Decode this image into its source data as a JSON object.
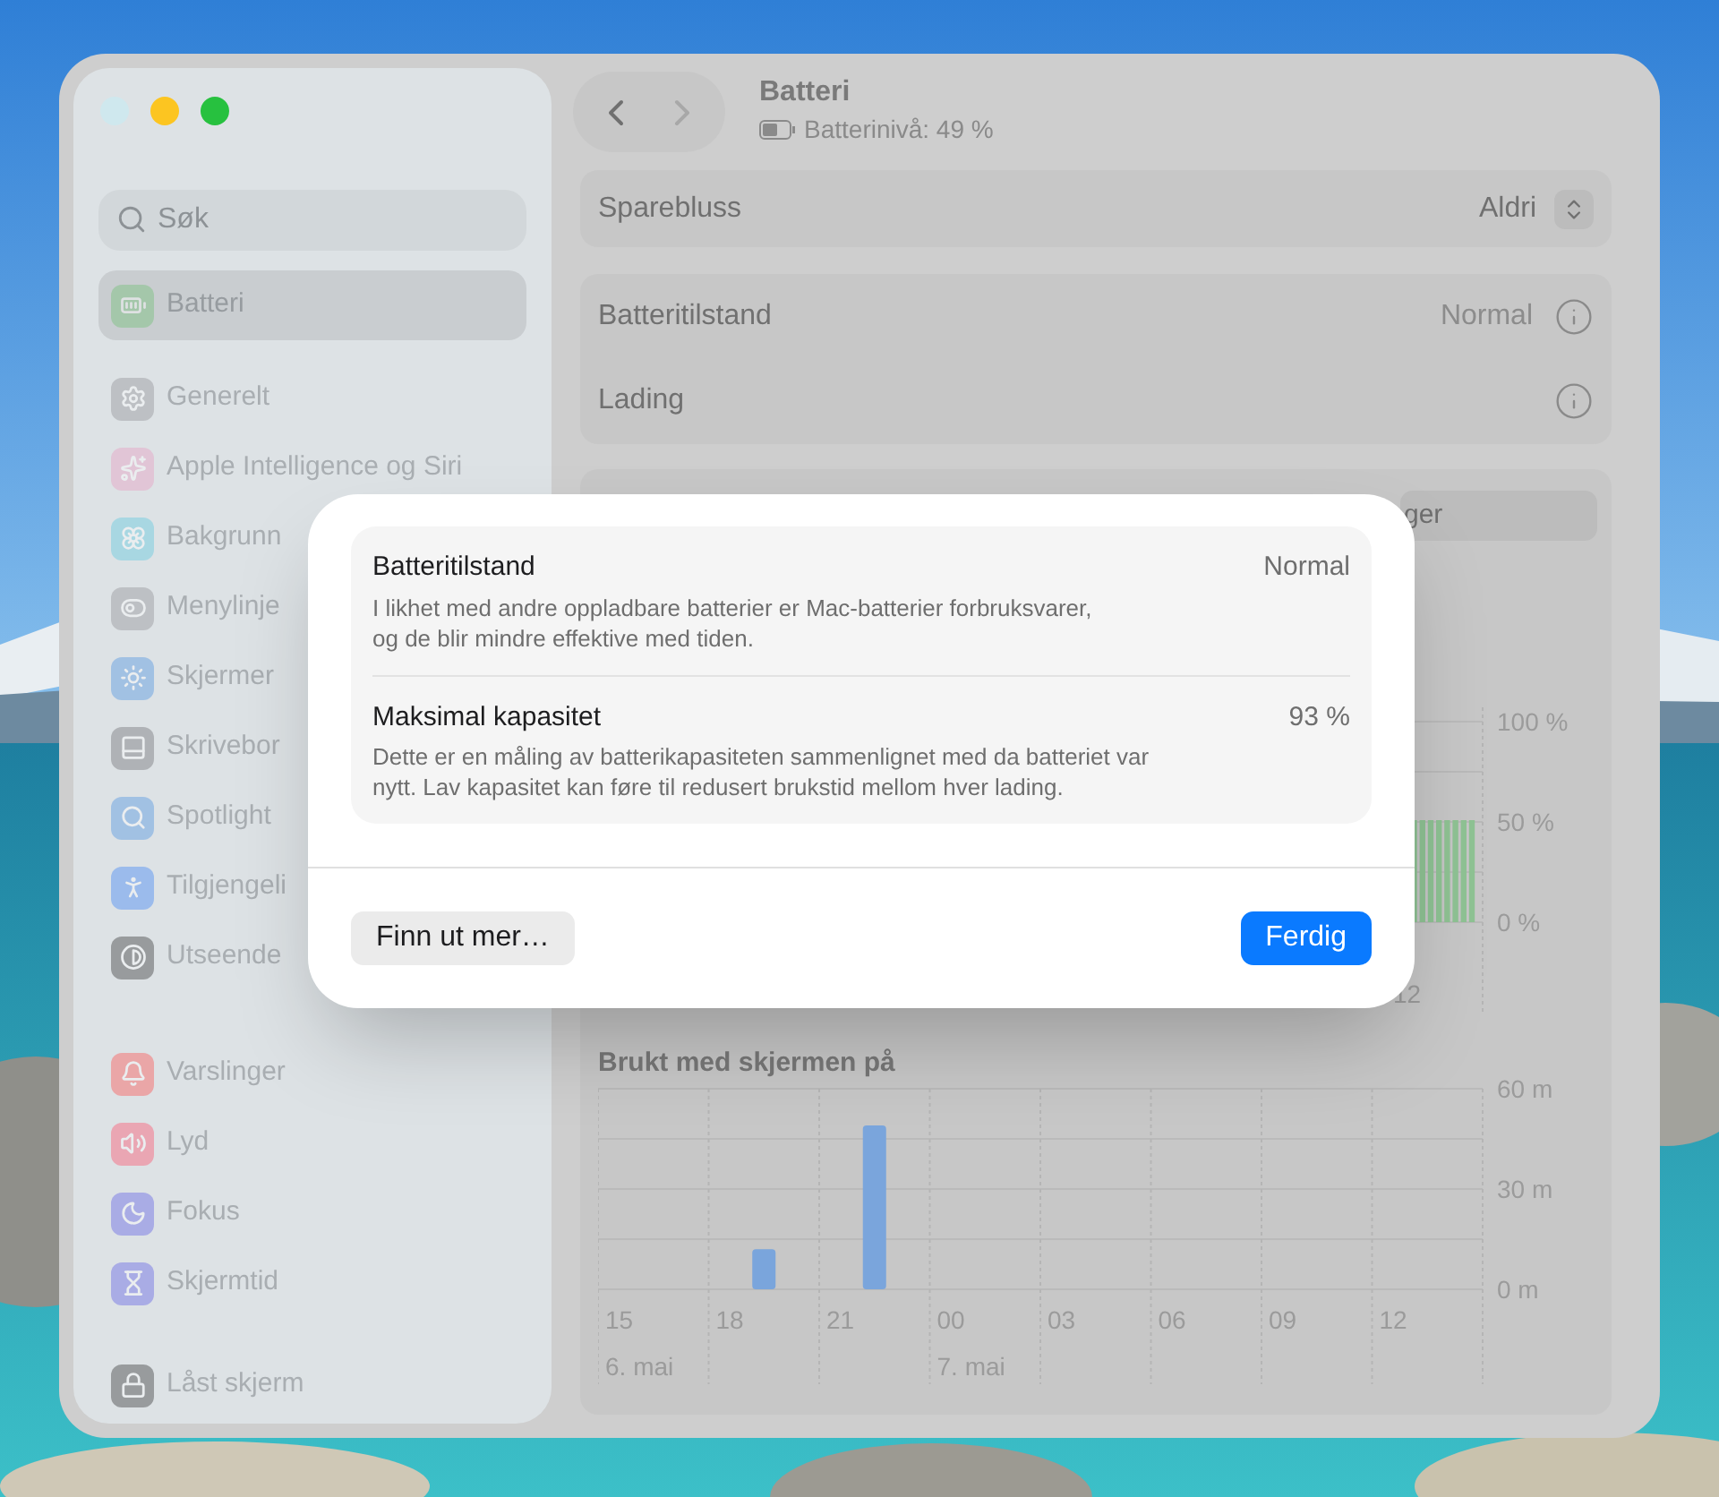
{
  "window": {
    "title": "Batteri",
    "subtitle": "Batterinivå: 49 %"
  },
  "sidebar": {
    "search": {
      "placeholder": "Søk"
    },
    "groups": [
      {
        "items": [
          {
            "label": "Batteri",
            "selected": true
          }
        ]
      },
      {
        "items": [
          {
            "label": "Generelt",
            "selected": false
          },
          {
            "label": "Apple Intelligence og Siri",
            "selected": false
          },
          {
            "label": "Bakgrunn",
            "selected": false
          },
          {
            "label": "Menylinje",
            "selected": false
          },
          {
            "label": "Skjermer",
            "selected": false
          },
          {
            "label": "Skrivebor",
            "selected": false
          },
          {
            "label": "Spotlight",
            "selected": false
          },
          {
            "label": "Tilgjengeli",
            "selected": false
          },
          {
            "label": "Utseende",
            "selected": false
          }
        ]
      },
      {
        "items": [
          {
            "label": "Varslinger",
            "selected": false
          },
          {
            "label": "Lyd",
            "selected": false
          },
          {
            "label": "Fokus",
            "selected": false
          },
          {
            "label": "Skjermtid",
            "selected": false
          }
        ]
      },
      {
        "items": [
          {
            "label": "Låst skjerm",
            "selected": false
          }
        ]
      }
    ]
  },
  "settings": {
    "low_power": {
      "label": "Sparebluss",
      "value": "Aldri"
    },
    "health_rows": [
      {
        "label": "Batteritilstand",
        "value": "Normal"
      },
      {
        "label": "Lading"
      }
    ],
    "range_segment": "ger",
    "level_chart": {
      "y_labels": [
        "100 %",
        "50 %",
        "0 %"
      ],
      "x_label": "12"
    },
    "usage": {
      "chart_data": {
        "type": "bar",
        "title": "Brukt med skjermen på",
        "categories": [
          "15",
          "18",
          "21",
          "00",
          "03",
          "06",
          "09",
          "12"
        ],
        "values": [
          0,
          12,
          49,
          0,
          0,
          0,
          0,
          0
        ],
        "ylim": [
          0,
          60
        ],
        "yticks": [
          {
            "value": 0,
            "label": "0 m"
          },
          {
            "value": 30,
            "label": "30 m"
          },
          {
            "value": 60,
            "label": "60 m"
          }
        ],
        "annotations": [
          "6. mai",
          "7. mai"
        ]
      }
    }
  },
  "sheet": {
    "rows": [
      {
        "title": "Batteritilstand",
        "value": "Normal",
        "description_lines": [
          "I likhet med andre oppladbare batterier er Mac-batterier forbruksvarer,",
          "og de blir mindre effektive med tiden."
        ]
      },
      {
        "title": "Maksimal kapasitet",
        "value": "93 %",
        "description_lines": [
          "Dette er en måling av batterikapasiteten sammenlignet med da batteriet var",
          "nytt. Lav kapasitet kan føre til redusert brukstid mellom hver lading."
        ]
      }
    ],
    "buttons": [
      {
        "label": "Finn ut mer…",
        "kind": "secondary"
      },
      {
        "label": "Ferdig",
        "kind": "primary"
      }
    ]
  }
}
